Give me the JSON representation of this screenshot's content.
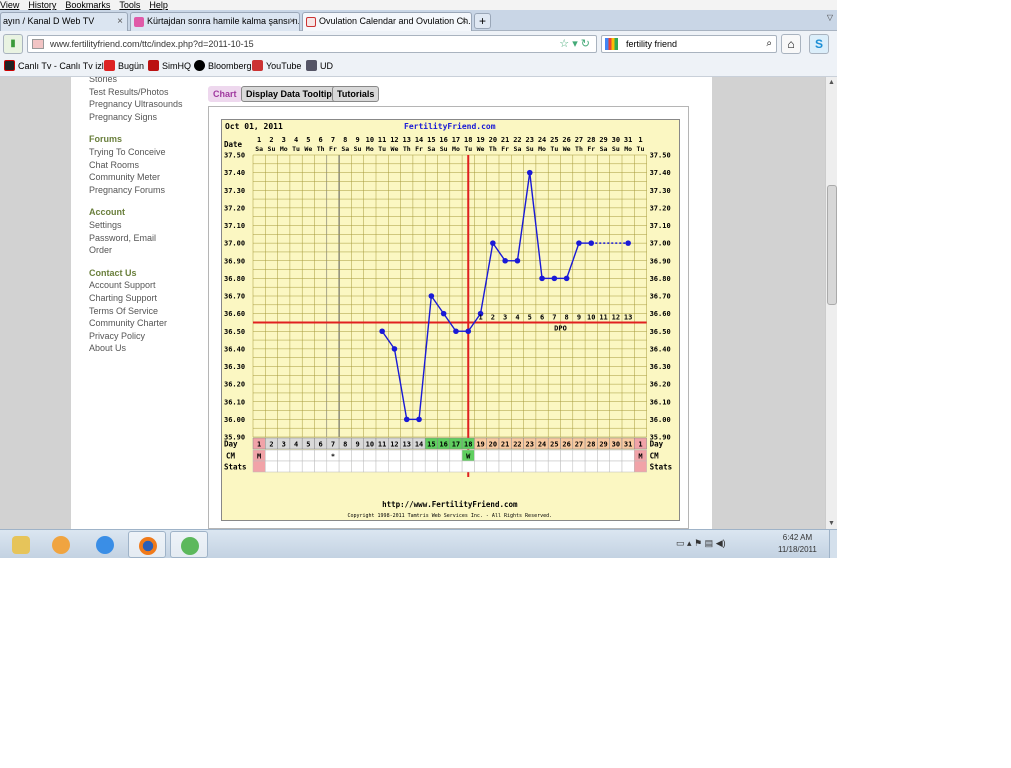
{
  "menubar": [
    "View",
    "History",
    "Bookmarks",
    "Tools",
    "Help"
  ],
  "tabs": [
    {
      "label": "ayın / Kanal D Web TV",
      "active": false
    },
    {
      "label": "Kürtajdan sonra hamile kalma şansı n...",
      "active": false
    },
    {
      "label": "Ovulation Calendar and Ovulation Ch...",
      "active": true
    }
  ],
  "newtab_label": "+",
  "url": "www.fertilityfriend.com/ttc/index.php?d=2011-10-15",
  "search_value": "fertility friend",
  "bookmarks": [
    "Canlı Tv - Canlı Tv izle",
    "Bugün",
    "SimHQ",
    "Bloomberg",
    "YouTube",
    "UD"
  ],
  "sidebar": {
    "top": [
      "Stories",
      "Test Results/Photos",
      "Pregnancy Ultrasounds",
      "Pregnancy Signs"
    ],
    "forums_head": "Forums",
    "forums": [
      "Trying To Conceive",
      "Chat Rooms",
      "Community Meter",
      "Pregnancy Forums"
    ],
    "account_head": "Account",
    "account": [
      "Settings",
      "Password, Email",
      "Order"
    ],
    "contact_head": "Contact Us",
    "contact": [
      "Account Support",
      "Charting Support",
      "Terms Of Service",
      "Community Charter",
      "Privacy Policy",
      "About Us"
    ]
  },
  "page_tabs": [
    "Chart",
    "Display Data Tooltip",
    "Tutorials"
  ],
  "taskbar": {
    "time": "6:42 AM",
    "date": "11/18/2011"
  },
  "colors": {
    "line": "#1a1ad6",
    "coverline": "#e02020",
    "ovulation": "#e02020",
    "fertile": "#5fcf5f",
    "luteal": "#f8c9a0",
    "menses": "#f1a3a8",
    "grid": "#a69a3a",
    "panel": "#fbf7c2"
  },
  "chart_data": {
    "type": "line",
    "header_date": "Oct 01, 2011",
    "site": "FertilityFriend.com",
    "footer_url": "http://www.FertilityFriend.com",
    "copyright": "Copyright 1998-2011 Tamtris Web Services Inc. - All Rights Reserved.",
    "row_labels": {
      "date": "Date",
      "day": "Day",
      "cm": "CM",
      "stats": "Stats"
    },
    "dates": [
      "1",
      "2",
      "3",
      "4",
      "5",
      "6",
      "7",
      "8",
      "9",
      "10",
      "11",
      "12",
      "13",
      "14",
      "15",
      "16",
      "17",
      "18",
      "19",
      "20",
      "21",
      "22",
      "23",
      "24",
      "25",
      "26",
      "27",
      "28",
      "29",
      "30",
      "31",
      "1"
    ],
    "weekdays": [
      "Sa",
      "Su",
      "Mo",
      "Tu",
      "We",
      "Th",
      "Fr",
      "Sa",
      "Su",
      "Mo",
      "Tu",
      "We",
      "Th",
      "Fr",
      "Sa",
      "Su",
      "Mo",
      "Tu",
      "We",
      "Th",
      "Fr",
      "Sa",
      "Su",
      "Mo",
      "Tu",
      "We",
      "Th",
      "Fr",
      "Sa",
      "Su",
      "Mo",
      "Tu"
    ],
    "cycle_days": [
      "1",
      "2",
      "3",
      "4",
      "5",
      "6",
      "7",
      "8",
      "9",
      "10",
      "11",
      "12",
      "13",
      "14",
      "15",
      "16",
      "17",
      "18",
      "19",
      "20",
      "21",
      "22",
      "23",
      "24",
      "25",
      "26",
      "27",
      "28",
      "29",
      "30",
      "31",
      "1"
    ],
    "day_shading": [
      "menses",
      "none",
      "none",
      "none",
      "none",
      "none",
      "none",
      "none",
      "none",
      "none",
      "none",
      "none",
      "none",
      "none",
      "fertile",
      "fertile",
      "fertile",
      "ovulation",
      "luteal",
      "luteal",
      "luteal",
      "luteal",
      "luteal",
      "luteal",
      "luteal",
      "luteal",
      "luteal",
      "luteal",
      "luteal",
      "luteal",
      "luteal",
      "menses"
    ],
    "cm_marks": [
      {
        "day": 1,
        "label": "M"
      },
      {
        "day": 7,
        "label": "*"
      },
      {
        "day": 18,
        "label": "W"
      },
      {
        "day": 32,
        "label": "M"
      }
    ],
    "yticks": [
      "37.50",
      "37.40",
      "37.30",
      "37.20",
      "37.10",
      "37.00",
      "36.90",
      "36.80",
      "36.70",
      "36.60",
      "36.50",
      "36.40",
      "36.30",
      "36.20",
      "36.10",
      "36.00",
      "35.90"
    ],
    "ylim": [
      35.9,
      37.5
    ],
    "coverline": 36.55,
    "ovulation_day": 18,
    "temps": [
      {
        "day": 11,
        "temp": 36.5
      },
      {
        "day": 12,
        "temp": 36.4
      },
      {
        "day": 13,
        "temp": 36.0
      },
      {
        "day": 14,
        "temp": 36.0
      },
      {
        "day": 15,
        "temp": 36.7
      },
      {
        "day": 16,
        "temp": 36.6
      },
      {
        "day": 17,
        "temp": 36.5
      },
      {
        "day": 18,
        "temp": 36.5
      },
      {
        "day": 19,
        "temp": 36.6
      },
      {
        "day": 20,
        "temp": 37.0
      },
      {
        "day": 21,
        "temp": 36.9
      },
      {
        "day": 22,
        "temp": 36.9
      },
      {
        "day": 23,
        "temp": 37.4
      },
      {
        "day": 24,
        "temp": 36.8
      },
      {
        "day": 25,
        "temp": 36.8
      },
      {
        "day": 26,
        "temp": 36.8
      },
      {
        "day": 27,
        "temp": 37.0
      },
      {
        "day": 28,
        "temp": 37.0
      },
      {
        "day": 31,
        "temp": 37.0
      }
    ],
    "dashed_from_day": 28,
    "dpo_numbers": [
      "1",
      "2",
      "3",
      "4",
      "5",
      "6",
      "7",
      "8",
      "9",
      "10",
      "11",
      "12",
      "13"
    ],
    "dpo_label": "DPO"
  }
}
